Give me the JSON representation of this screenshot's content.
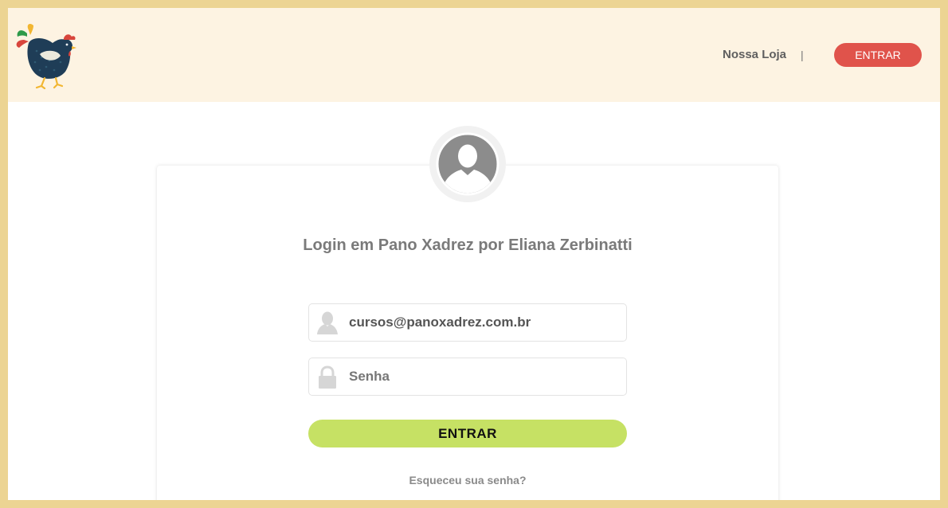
{
  "header": {
    "logo_alt": "rooster-logo",
    "nav_link": "Nossa Loja",
    "separator": "|",
    "login_button": "ENTRAR"
  },
  "login": {
    "title": "Login em Pano Xadrez por Eliana Zerbinatti",
    "email_value": "cursos@panoxadrez.com.br",
    "password_placeholder": "Senha",
    "submit_label": "ENTRAR",
    "forgot_link": "Esqueceu sua senha?"
  },
  "colors": {
    "border": "#ecd493",
    "header_bg": "#fdf3e2",
    "header_button": "#e0534b",
    "submit_button": "#c6e164"
  },
  "icons": [
    "rooster-logo",
    "user-avatar-icon",
    "user-icon",
    "lock-icon"
  ]
}
